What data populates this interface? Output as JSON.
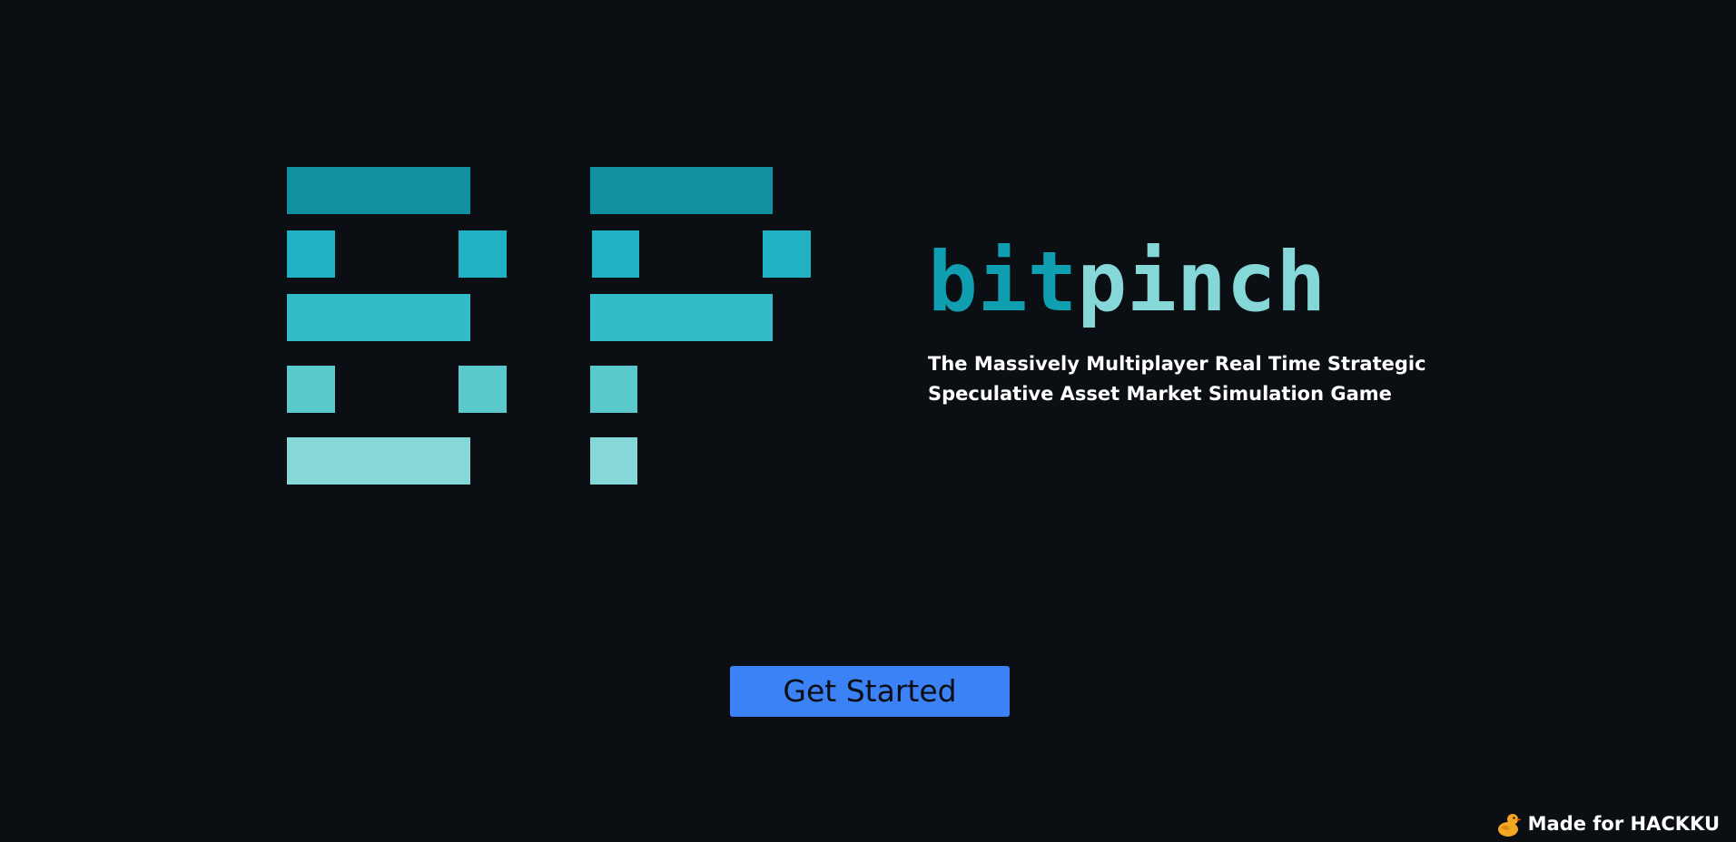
{
  "brand": {
    "name_part_a": "bit",
    "name_part_b": "pinch",
    "colors": {
      "primary": "#0f9fb1",
      "secondary": "#86d7d8"
    }
  },
  "tagline": "The Massively Multiplayer Real Time Strategic Speculative Asset Market Simulation Game",
  "cta": {
    "label": "Get Started",
    "color": "#3b82f6"
  },
  "footer": {
    "made_for_text": "Made for HACKKU",
    "icon": "duck-icon"
  },
  "logo": {
    "icon": "bp-block-logo",
    "palette": [
      "#0f91a2",
      "#22b0c3",
      "#33bbc8",
      "#5ac9cd",
      "#86d7d8"
    ]
  },
  "background_color": "#0b0f14"
}
